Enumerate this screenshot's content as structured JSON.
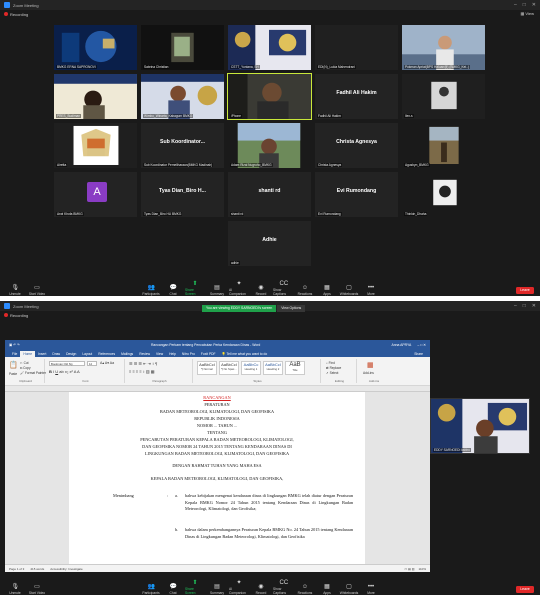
{
  "window1": {
    "title": "Zoom Meeting",
    "recording": "Recording",
    "view": "View",
    "participants": [
      {
        "name": "BMKG ERNA SAPRONOVI",
        "kind": "video"
      },
      {
        "name": "Sabrina Christian",
        "kind": "video"
      },
      {
        "name": "CSTT_Yuniana, SH",
        "kind": "video"
      },
      {
        "name": "EDI(N)_Lukia Mahendrani",
        "kind": "video"
      },
      {
        "name": "Pokman Apriat(BPS Haluan@) (BMKG_Kei..)",
        "kind": "video"
      },
      {
        "name": "PRES_Budiman",
        "kind": "video"
      },
      {
        "name": "Wimbo_Winarta_Kabagum BMKG",
        "kind": "video"
      },
      {
        "name": "iPhone",
        "kind": "video"
      },
      {
        "name": "Fadhil Ali Hakim",
        "kind": "name"
      },
      {
        "name": "Ilex-s",
        "kind": "video"
      },
      {
        "name": "Airetta",
        "kind": "video"
      },
      {
        "name": "Sub Koordinator...",
        "sub": "Sub Koordinator Pemeliharaan(BMKG Madinah)",
        "kind": "name"
      },
      {
        "name": "Adam Rizal Nugroho_BMKG",
        "kind": "video"
      },
      {
        "name": "Christa Agnesya",
        "kind": "name"
      },
      {
        "name": "Agusbyn_BMKG",
        "kind": "video"
      },
      {
        "name": "A",
        "sub": "Arwi Khofa BMKG",
        "kind": "avatar"
      },
      {
        "name": "Tyas Dian_Biro H...",
        "sub": "Tyas Dian_Biro HU BMKG",
        "kind": "name"
      },
      {
        "name": "shanti rd",
        "kind": "name"
      },
      {
        "name": "Evi Rumondang",
        "kind": "name"
      },
      {
        "name": "Thinkin_Dhaha",
        "kind": "video"
      },
      {
        "name": "Adhie",
        "sub": "adhie",
        "kind": "name"
      }
    ],
    "toolbar": [
      "Unmute",
      "Start Video",
      "Participants",
      "Chat",
      "Share Screen",
      "Summary",
      "AI Companion",
      "Record",
      "Show Captions",
      "Reactions",
      "Apps",
      "Whiteboards",
      "More"
    ],
    "end": "Leave"
  },
  "window2": {
    "title": "Zoom Meeting",
    "recording": "Recording",
    "banner_status": "You are viewing EDDY SARNOEDI's screen",
    "banner_options": "View Options",
    "word": {
      "doc_title": "Rancangan Perkam tentang Pencabutan Perka Kendaraan Dinas - Word",
      "user": "Anna APRYA",
      "tabs": [
        "File",
        "Home",
        "Insert",
        "Draw",
        "Design",
        "Layout",
        "References",
        "Mailings",
        "Review",
        "View",
        "Help",
        "Nitro Pro",
        "Foxit PDF"
      ],
      "tell_me": "Tell me what you want to do",
      "share": "Share",
      "font_name": "Bookman Old Sty",
      "font_size": "12",
      "groups": [
        "Clipboard",
        "Font",
        "Paragraph",
        "Styles",
        "Editing",
        "Add-ins"
      ],
      "clipboard": [
        "Paste",
        "Cut",
        "Copy",
        "Format Painter"
      ],
      "styles": [
        {
          "sample": "AaBbCcI",
          "name": "¶ Normal"
        },
        {
          "sample": "AaBbCcI",
          "name": "¶ No Spac..."
        },
        {
          "sample": "AaBbCc",
          "name": "Heading 1"
        },
        {
          "sample": "AaBbCcI",
          "name": "Heading 2"
        },
        {
          "sample": "AaB",
          "name": "Title"
        }
      ],
      "editing": [
        "Find",
        "Replace",
        "Select"
      ],
      "addins": "Add-ins",
      "doc_lines": [
        "RANCANGAN",
        "PERATURAN",
        "BADAN METEOROLOGI, KLIMATOLOGI, DAN GEOFISIKA",
        "REPUBLIK INDONESIA",
        "NOMOR ... TAHUN ...",
        "TENTANG",
        "PENCABUTAN PERATURAN KEPALA BADAN METEOROLOGI, KLIMATOLOGI,",
        "DAN GEOFISIKA NOMOR 24 TAHUN 2015 TENTANG KENDARAAN DINAS DI",
        "LINGKUNGAN BADAN METEOROLOGI, KLIMATOLOGI, DAN GEOFISIKA",
        "DENGAN RAHMAT TUHAN YANG MAHA ESA",
        "KEPALA BADAN METEOROLOGI, KLIMATOLOGI, DAN GEOFISIKA,"
      ],
      "menimbang": "Menimbang",
      "colon": ":",
      "item_a_label": "a.",
      "item_a": "bahwa kebijakan mengenai kendaraan dinas di lingkungan BMKG telah diatur dengan Peraturan Kepala BMKG Nomor 24 Tahun 2015 tentang Kendaraan Dinas di Lingkungan Badan Meteorologi, Klimatologi, dan Geofisika;",
      "item_b_label": "b.",
      "item_b": "bahwa dalam perkembangannya Peraturan Kepala BMKG No. 24 Tahun 2015 tentang Kendaraan Dinas di Lingkungan Badan Meteorologi, Klimatologi, dan Geofisika",
      "status_page": "Page 1 of 3",
      "status_words": "415 words",
      "status_acc": "Accessibility: Investigate",
      "status_zoom": "110%"
    },
    "self_name": "EDDY SARNOEDI kabiro",
    "toolbar": [
      "Unmute",
      "Start Video",
      "Participants",
      "Chat",
      "Share Screen",
      "Summary",
      "AI Companion",
      "Record",
      "Show Captions",
      "Reactions",
      "Apps",
      "Whiteboards",
      "More"
    ],
    "end": "Leave"
  }
}
